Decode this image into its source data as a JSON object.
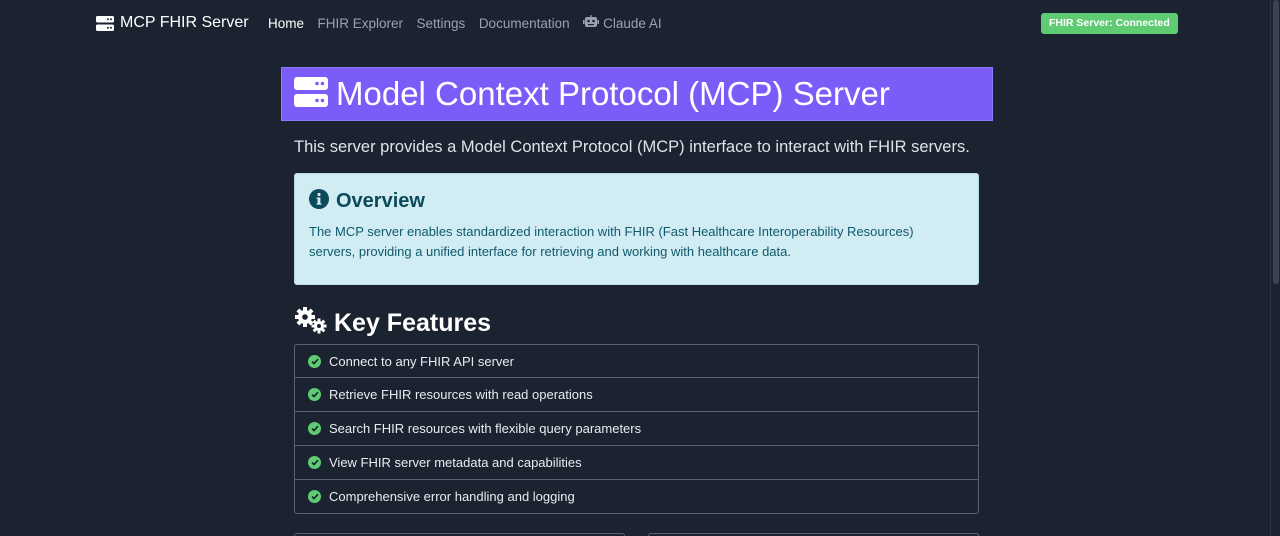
{
  "navbar": {
    "brand": "MCP FHIR Server",
    "links": [
      {
        "label": "Home",
        "active": true
      },
      {
        "label": "FHIR Explorer",
        "active": false
      },
      {
        "label": "Settings",
        "active": false
      },
      {
        "label": "Documentation",
        "active": false
      },
      {
        "label": "Claude AI",
        "active": false,
        "icon": "robot-icon"
      }
    ],
    "status": "FHIR Server: Connected"
  },
  "hero": {
    "title": "Model Context Protocol (MCP) Server",
    "icon": "server-icon"
  },
  "intro": "This server provides a Model Context Protocol (MCP) interface to interact with FHIR servers.",
  "overview": {
    "title": "Overview",
    "icon": "info-icon",
    "text": "The MCP server enables standardized interaction with FHIR (Fast Healthcare Interoperability Resources) servers, providing a unified interface for retrieving and working with healthcare data."
  },
  "features": {
    "title": "Key Features",
    "icon": "gears-icon",
    "items": [
      "Connect to any FHIR API server",
      "Retrieve FHIR resources with read operations",
      "Search FHIR resources with flexible query parameters",
      "View FHIR server metadata and capabilities",
      "Comprehensive error handling and logging"
    ]
  },
  "colors": {
    "background": "#1b2230",
    "hero": "#7c5cf8",
    "overview_bg": "#d1ecf2",
    "success": "#5fcb73"
  }
}
